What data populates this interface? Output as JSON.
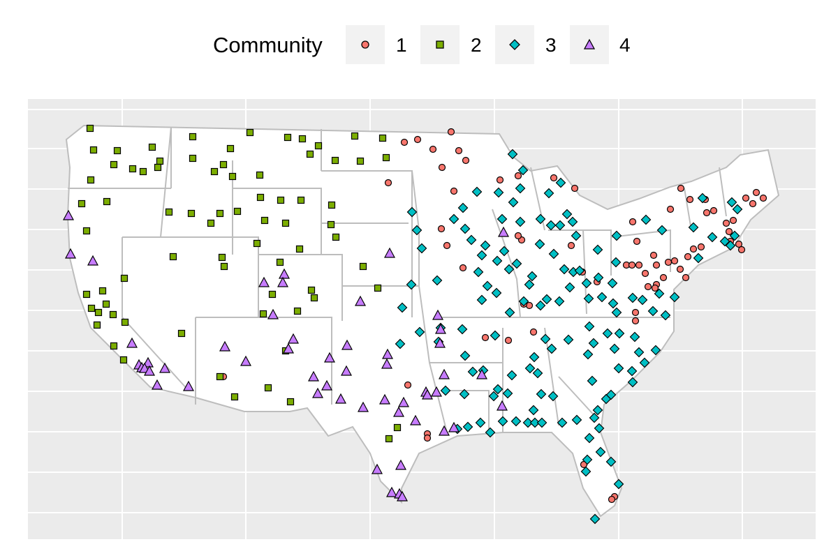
{
  "legend": {
    "title": "Community",
    "items": [
      {
        "label": "1",
        "shape": "circle",
        "color": "#F8766D"
      },
      {
        "label": "2",
        "shape": "square",
        "color": "#7CAE00"
      },
      {
        "label": "3",
        "shape": "diamond",
        "color": "#00BFC4"
      },
      {
        "label": "4",
        "shape": "triangle",
        "color": "#C77CFF"
      }
    ],
    "key_background": "#F2F2F2"
  },
  "map": {
    "region": "contiguous United States",
    "panel_background": "#EBEBEB",
    "grid_color": "#FFFFFF",
    "land_fill": "#FFFFFF",
    "border_color": "#BDBDBD",
    "marker_outline": "#000000"
  }
}
